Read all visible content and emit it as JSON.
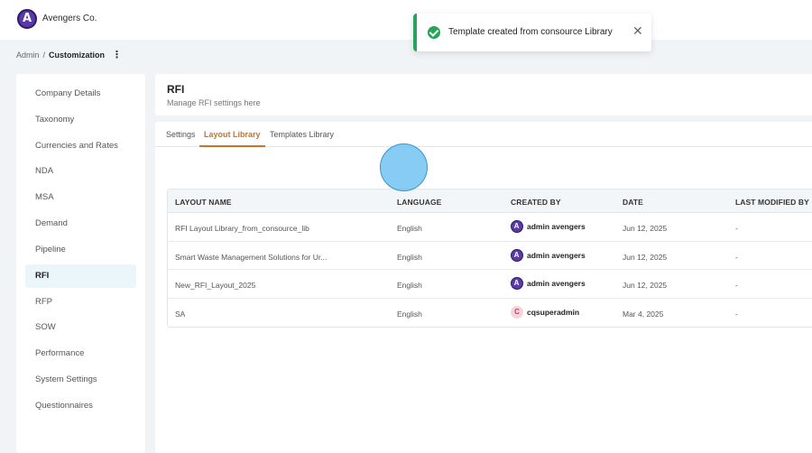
{
  "app": {
    "brand_name": "Avengers Co."
  },
  "breadcrumb": {
    "root": "Admin",
    "separator": "/",
    "current": "Customization",
    "menu_glyph": "⋮"
  },
  "sidebar": {
    "items": [
      {
        "label": "Company Details",
        "active": false
      },
      {
        "label": "Taxonomy",
        "active": false
      },
      {
        "label": "Currencies and Rates",
        "active": false
      },
      {
        "label": "NDA",
        "active": false
      },
      {
        "label": "MSA",
        "active": false
      },
      {
        "label": "Demand",
        "active": false
      },
      {
        "label": "Pipeline",
        "active": false
      },
      {
        "label": "RFI",
        "active": true
      },
      {
        "label": "RFP",
        "active": false
      },
      {
        "label": "SOW",
        "active": false
      },
      {
        "label": "Performance",
        "active": false
      },
      {
        "label": "System Settings",
        "active": false
      },
      {
        "label": "Questionnaires",
        "active": false
      }
    ]
  },
  "page": {
    "title": "RFI",
    "subtitle": "Manage RFI settings here"
  },
  "tabs": [
    {
      "label": "Settings",
      "active": false
    },
    {
      "label": "Layout Library",
      "active": true
    },
    {
      "label": "Templates Library",
      "active": false
    }
  ],
  "table": {
    "columns": [
      "LAYOUT NAME",
      "LANGUAGE",
      "CREATED BY",
      "DATE",
      "LAST MODIFIED BY"
    ],
    "rows": [
      {
        "name": "RFI Layout Library_from_consource_lib",
        "language": "English",
        "created_by": "admin avengers",
        "avatar": "logo",
        "date": "Jun 12, 2025",
        "last_modified": "-"
      },
      {
        "name": "Smart Waste Management Solutions for Ur...",
        "language": "English",
        "created_by": "admin avengers",
        "avatar": "logo",
        "date": "Jun 12, 2025",
        "last_modified": "-"
      },
      {
        "name": "New_RFI_Layout_2025",
        "language": "English",
        "created_by": "admin avengers",
        "avatar": "logo",
        "date": "Jun 12, 2025",
        "last_modified": "-"
      },
      {
        "name": "SA",
        "language": "English",
        "created_by": "cqsuperadmin",
        "avatar": "C",
        "date": "Mar 4, 2025",
        "last_modified": "-"
      }
    ]
  },
  "toast": {
    "message": "Template created from consource Library",
    "icon": "check-circle-icon",
    "close_glyph": "✕",
    "color": "#27a35a"
  },
  "colors": {
    "accent": "#c8742a",
    "active_bg": "#eaf6fa",
    "success": "#27a35a"
  }
}
